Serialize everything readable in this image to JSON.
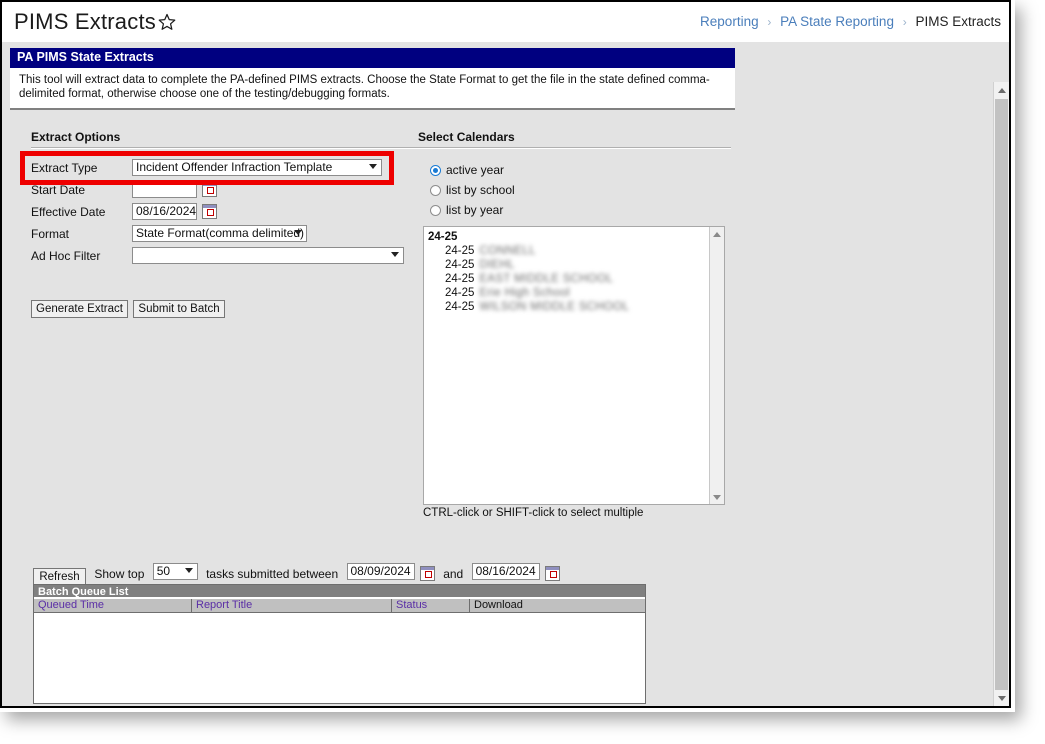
{
  "window": {
    "page_title": "PIMS Extracts",
    "favorite_icon": "star-icon"
  },
  "breadcrumb": {
    "items": [
      {
        "label": "Reporting",
        "link": true
      },
      {
        "label": "PA State Reporting",
        "link": true
      },
      {
        "label": "PIMS Extracts",
        "link": false
      }
    ],
    "separator": "›"
  },
  "panel": {
    "header": "PA PIMS State Extracts",
    "description": "This tool will extract data to complete the PA-defined PIMS extracts. Choose the State Format to get the file in the state defined comma-delimited format, otherwise choose one of the testing/debugging formats."
  },
  "extract_options": {
    "section_title": "Extract Options",
    "extract_type": {
      "label": "Extract Type",
      "value": "Incident Offender Infraction Template",
      "highlighted": true,
      "highlight_color": "#ee0000"
    },
    "start_date": {
      "label": "Start Date",
      "value": "",
      "placeholder": ""
    },
    "effective_date": {
      "label": "Effective Date",
      "value": "08/16/2024"
    },
    "format": {
      "label": "Format",
      "value": "State Format(comma delimited)"
    },
    "ad_hoc_filter": {
      "label": "Ad Hoc Filter",
      "value": ""
    },
    "buttons": {
      "generate": "Generate Extract",
      "submit_batch": "Submit to Batch"
    }
  },
  "select_calendars": {
    "section_title": "Select Calendars",
    "radios": [
      {
        "label": "active year",
        "selected": true
      },
      {
        "label": "list by school",
        "selected": false
      },
      {
        "label": "list by year",
        "selected": false
      }
    ],
    "list": {
      "group_label": "24-25",
      "items": [
        {
          "year": "24-25",
          "name": "CONNELL",
          "redacted": true
        },
        {
          "year": "24-25",
          "name": "DIEHL",
          "redacted": true
        },
        {
          "year": "24-25",
          "name": "EAST MIDDLE SCHOOL",
          "redacted": true
        },
        {
          "year": "24-25",
          "name": "Erie High School",
          "redacted": true
        },
        {
          "year": "24-25",
          "name": "WILSON MIDDLE SCHOOL",
          "redacted": true
        }
      ]
    },
    "hint": "CTRL-click or SHIFT-click to select multiple"
  },
  "batch": {
    "refresh_label": "Refresh",
    "show_top_label": "Show top",
    "show_top_value": "50",
    "between_label": "tasks submitted between",
    "from_date": "08/09/2024",
    "and_label": "and",
    "to_date": "08/16/2024",
    "queue": {
      "title": "Batch Queue List",
      "columns": [
        "Queued Time",
        "Report Title",
        "Status",
        "Download"
      ],
      "rows": []
    }
  }
}
